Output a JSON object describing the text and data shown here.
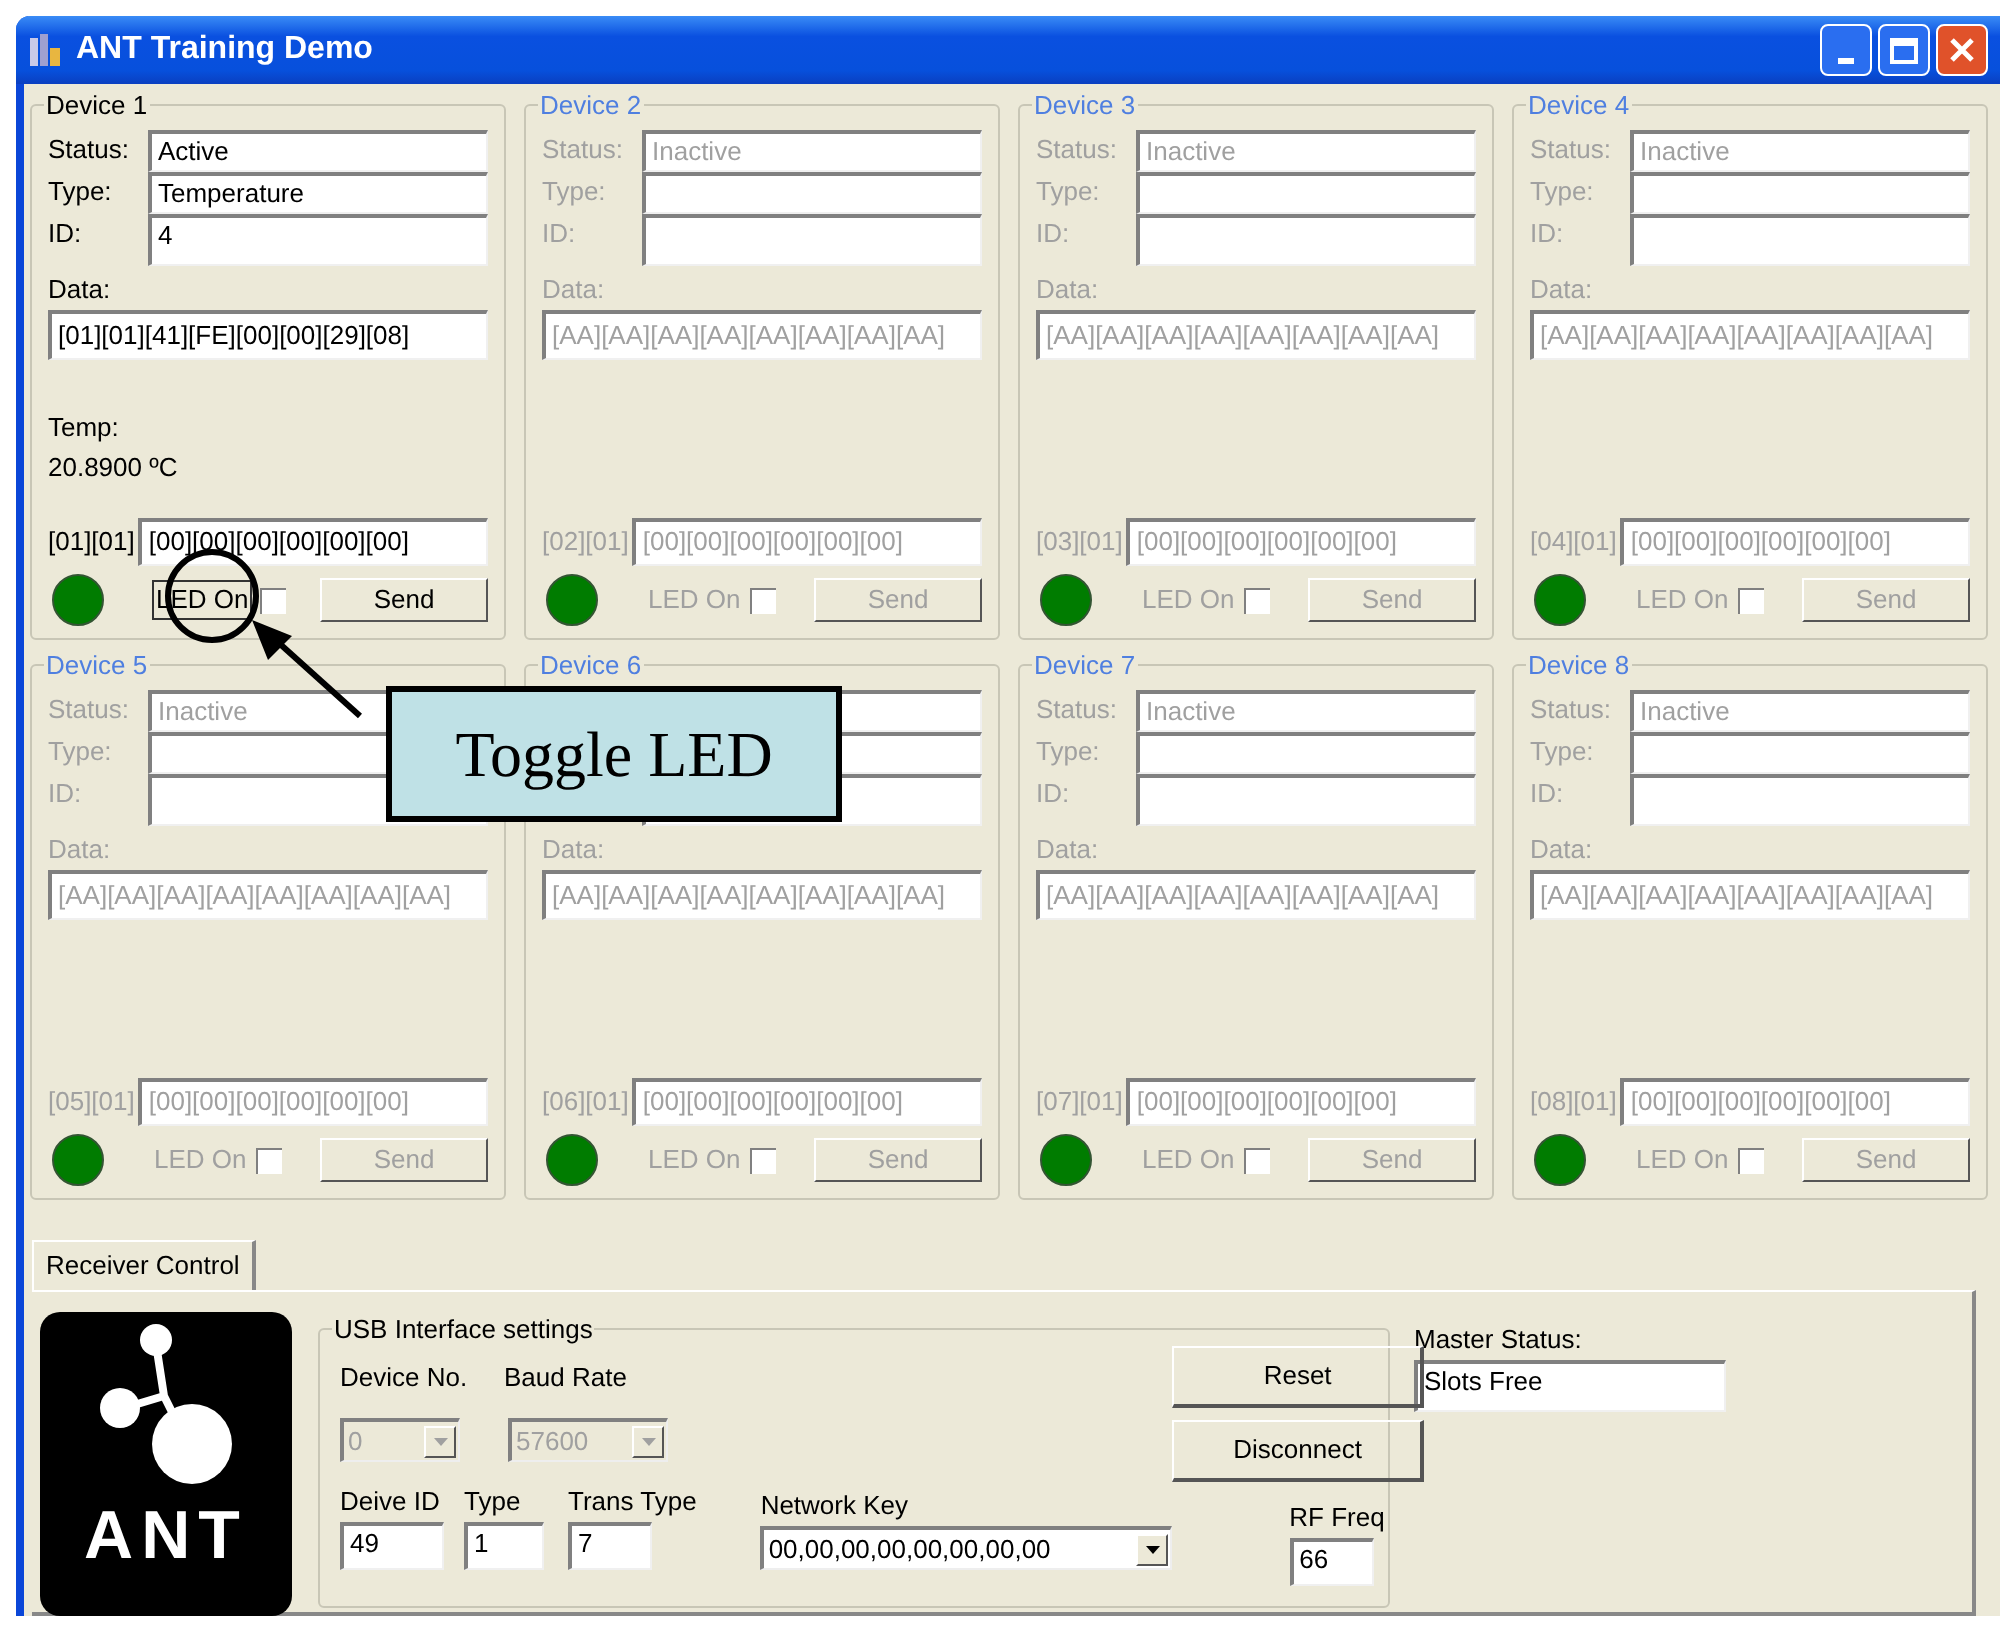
{
  "window": {
    "title": "ANT Training Demo"
  },
  "devices": [
    {
      "title": "Device 1",
      "active": true,
      "labels": {
        "status": "Status:",
        "type": "Type:",
        "id": "ID:",
        "data": "Data:"
      },
      "status": "Active",
      "type": "Temperature",
      "id": "4",
      "data": "[01][01][41][FE][00][00][29][08]",
      "temp_label": "Temp:",
      "temp_value": "20.8900 ºC",
      "channel": "[01][01]",
      "payload": "[00][00][00][00][00][00]",
      "led_label": "LED On",
      "led_checked": false,
      "send": "Send"
    },
    {
      "title": "Device 2",
      "active": false,
      "labels": {
        "status": "Status:",
        "type": "Type:",
        "id": "ID:",
        "data": "Data:"
      },
      "status": "Inactive",
      "data": "[AA][AA][AA][AA][AA][AA][AA][AA]",
      "channel": "[02][01]",
      "payload": "[00][00][00][00][00][00]",
      "led_label": "LED On",
      "led_checked": false,
      "send": "Send"
    },
    {
      "title": "Device 3",
      "active": false,
      "labels": {
        "status": "Status:",
        "type": "Type:",
        "id": "ID:",
        "data": "Data:"
      },
      "status": "Inactive",
      "data": "[AA][AA][AA][AA][AA][AA][AA][AA]",
      "channel": "[03][01]",
      "payload": "[00][00][00][00][00][00]",
      "led_label": "LED On",
      "led_checked": false,
      "send": "Send"
    },
    {
      "title": "Device 4",
      "active": false,
      "labels": {
        "status": "Status:",
        "type": "Type:",
        "id": "ID:",
        "data": "Data:"
      },
      "status": "Inactive",
      "data": "[AA][AA][AA][AA][AA][AA][AA][AA]",
      "channel": "[04][01]",
      "payload": "[00][00][00][00][00][00]",
      "led_label": "LED On",
      "led_checked": false,
      "send": "Send"
    },
    {
      "title": "Device 5",
      "active": false,
      "labels": {
        "status": "Status:",
        "type": "Type:",
        "id": "ID:",
        "data": "Data:"
      },
      "status": "Inactive",
      "data": "[AA][AA][AA][AA][AA][AA][AA][AA]",
      "channel": "[05][01]",
      "payload": "[00][00][00][00][00][00]",
      "led_label": "LED On",
      "led_checked": false,
      "send": "Send"
    },
    {
      "title": "Device 6",
      "active": false,
      "labels": {
        "data": "Data:"
      },
      "data": "[AA][AA][AA][AA][AA][AA][AA][AA]",
      "channel": "[06][01]",
      "payload": "[00][00][00][00][00][00]",
      "led_label": "LED On",
      "led_checked": false,
      "send": "Send"
    },
    {
      "title": "Device 7",
      "active": false,
      "labels": {
        "status": "Status:",
        "type": "Type:",
        "id": "ID:",
        "data": "Data:"
      },
      "status": "Inactive",
      "data": "[AA][AA][AA][AA][AA][AA][AA][AA]",
      "channel": "[07][01]",
      "payload": "[00][00][00][00][00][00]",
      "led_label": "LED On",
      "led_checked": false,
      "send": "Send"
    },
    {
      "title": "Device 8",
      "active": false,
      "labels": {
        "status": "Status:",
        "type": "Type:",
        "id": "ID:",
        "data": "Data:"
      },
      "status": "Inactive",
      "data": "[AA][AA][AA][AA][AA][AA][AA][AA]",
      "channel": "[08][01]",
      "payload": "[00][00][00][00][00][00]",
      "led_label": "LED On",
      "led_checked": false,
      "send": "Send"
    }
  ],
  "callout": {
    "text": "Toggle LED"
  },
  "tabs": [
    {
      "label": "Receiver Control",
      "selected": true
    }
  ],
  "receiver": {
    "logo_text": "ANT",
    "usb_group": "USB Interface settings",
    "device_no": {
      "label": "Device No.",
      "value": "0",
      "disabled": true
    },
    "baud_rate": {
      "label": "Baud Rate",
      "value": "57600",
      "disabled": true
    },
    "device_id": {
      "label": "Deive ID",
      "value": "49"
    },
    "type": {
      "label": "Type",
      "value": "1"
    },
    "trans_type": {
      "label": "Trans Type",
      "value": "7"
    },
    "network_key": {
      "label": "Network Key",
      "value": "00,00,00,00,00,00,00,00"
    },
    "rf_freq": {
      "label": "RF Freq",
      "value": "66"
    },
    "buttons": [
      "Reset",
      "Disconnect"
    ],
    "master_status": {
      "label": "Master Status:",
      "value": "Slots Free"
    }
  }
}
